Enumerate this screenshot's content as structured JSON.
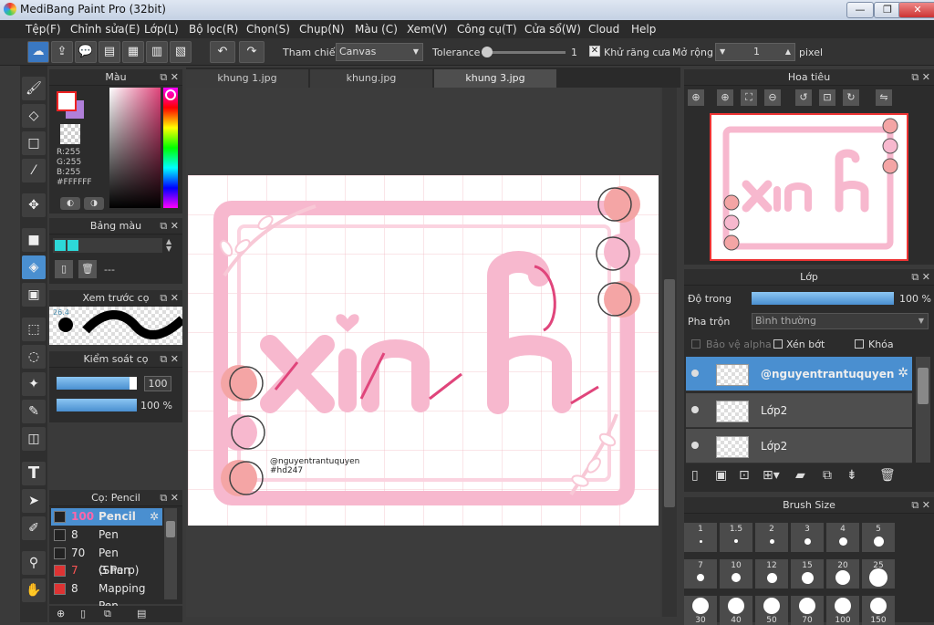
{
  "window": {
    "title": "MediBang Paint Pro (32bit)",
    "minimize": "—",
    "maximize": "❐",
    "close": "✕"
  },
  "menu": [
    "Tệp(F)",
    "Chỉnh sửa(E)",
    "Lớp(L)",
    "Bộ lọc(R)",
    "Chọn(S)",
    "Chụp(N)",
    "Màu (C)",
    "Xem(V)",
    "Công cụ(T)",
    "Cửa sổ(W)",
    "Cloud",
    "Help"
  ],
  "toolbar": {
    "reference_label": "Tham chiếu",
    "reference_value": "Canvas",
    "tolerance_label": "Tolerance",
    "tolerance_value": "1",
    "antialias_label": "Khử răng cưa",
    "expand_label": "Mở rộng",
    "expand_value": "1",
    "expand_unit": "pixel"
  },
  "tabs": [
    "khung 1.jpg",
    "khung.jpg",
    "khung 3.jpg"
  ],
  "color_panel": {
    "title": "Màu",
    "r": "R:255",
    "g": "G:255",
    "b": "B:255",
    "hex": "#FFFFFF"
  },
  "palette_panel": {
    "title": "Bảng màu",
    "dashes": "---"
  },
  "brush_preview_panel": {
    "title": "Xem trước cọ",
    "size": "26.4"
  },
  "brush_control_panel": {
    "title": "Kiểm soát cọ",
    "size_value": "100",
    "opacity_value": "100 %",
    "size_fraction": 1.0,
    "opacity_fraction": 1.0
  },
  "brush_list_panel": {
    "title": "Cọ: Pencil",
    "items": [
      {
        "size": "100",
        "name": "Pencil",
        "color": "#222222"
      },
      {
        "size": "8",
        "name": "Pen",
        "color": "#222222"
      },
      {
        "size": "70",
        "name": "Pen (Sharp)",
        "color": "#222222"
      },
      {
        "size": "7",
        "name": "G Pen",
        "color": "#dd3333"
      },
      {
        "size": "8",
        "name": "Mapping Pen",
        "color": "#dd3333"
      }
    ]
  },
  "navigator_panel": {
    "title": "Hoa tiêu"
  },
  "layer_panel": {
    "title": "Lớp",
    "opacity_label": "Độ trong",
    "opacity_value": "100 %",
    "opacity_fraction": 1.0,
    "blend_label": "Pha trộn",
    "blend_value": "Bình thường",
    "protect_alpha": "Bảo vệ alpha",
    "clipping": "Xén bớt",
    "lock": "Khóa",
    "layers": [
      {
        "name": "@nguyentrantuquyen",
        "selected": true
      },
      {
        "name": "Lớp2",
        "selected": false
      },
      {
        "name": "Lớp2",
        "selected": false
      }
    ]
  },
  "brush_size_panel": {
    "title": "Brush Size",
    "sizes": [
      "1",
      "1.5",
      "2",
      "3",
      "4",
      "5",
      "7",
      "10",
      "12",
      "15",
      "20",
      "25",
      "30",
      "40",
      "50",
      "70",
      "100",
      "150"
    ]
  },
  "artwork": {
    "word": "xinh",
    "credit": "@nguyentrantuquyen",
    "tag": "#hd247"
  },
  "colors": {
    "accent": "#4a8fd0",
    "pink": "#f7b8ce",
    "deep_pink": "#e0457b",
    "peach": "#f4a5a5"
  }
}
